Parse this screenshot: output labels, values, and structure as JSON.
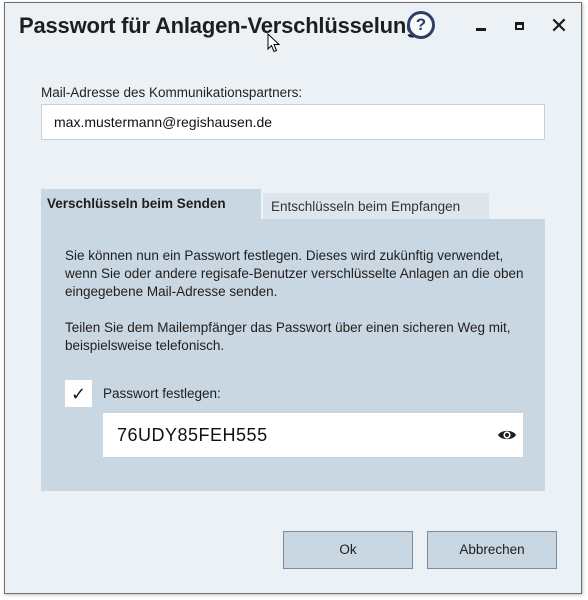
{
  "window": {
    "title": "Passwort für Anlagen-Verschlüsselung",
    "help_glyph": "?",
    "close_glyph": "✕",
    "icons": [
      "help-icon",
      "minimize-icon",
      "maximize-icon",
      "close-icon",
      "cursor-icon"
    ]
  },
  "email": {
    "label": "Mail-Adresse des Kommunikationspartners:",
    "value": "max.mustermann@regishausen.de"
  },
  "tabs": [
    {
      "label": "Verschlüsseln beim Senden",
      "active": true
    },
    {
      "label": "Entschlüsseln beim Empfangen",
      "active": false
    }
  ],
  "panel": {
    "paragraph1": "Sie können nun ein Passwort festlegen. Dieses wird zukünftig verwendet, wenn Sie oder andere regisafe-Benutzer verschlüsselte Anlagen an die oben eingegebene Mail-Adresse senden.",
    "paragraph2": "Teilen Sie dem Mailempfänger das Passwort über einen sicheren Weg mit, beispielsweise telefonisch.",
    "checkbox": {
      "label": "Passwort festlegen:",
      "checked": true,
      "check_glyph": "✓"
    },
    "password": {
      "value": "76UDY85FEH555",
      "reveal_icon": "eye-icon"
    }
  },
  "buttons": {
    "ok": "Ok",
    "cancel": "Abbrechen"
  },
  "colors": {
    "dialog_background": "#ecf1f6",
    "panel_background": "#c9d7e2",
    "inactive_tab": "#dde6ed",
    "help_icon": "#2f3e63"
  }
}
